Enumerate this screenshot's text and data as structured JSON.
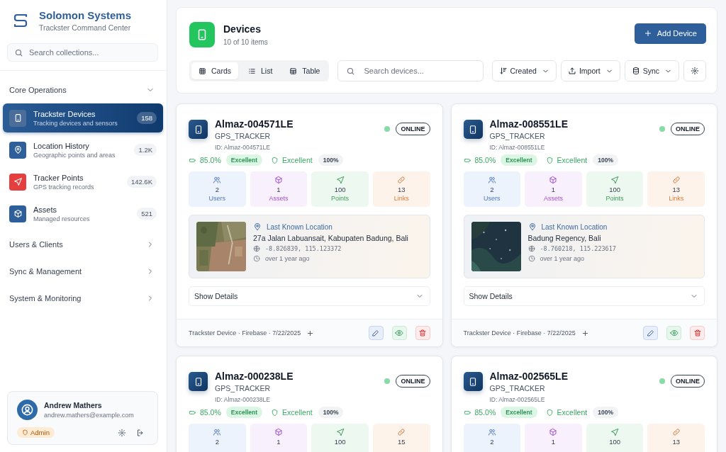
{
  "brand": {
    "title": "Solomon Systems",
    "subtitle": "Trackster Command Center"
  },
  "sidebar": {
    "search": {
      "placeholder": "Search collections..."
    },
    "sections": [
      {
        "label": "Core Operations",
        "expanded": true,
        "items": [
          {
            "title": "Trackster Devices",
            "subtitle": "Tracking devices and sensors",
            "count": "158",
            "selected": true,
            "kind": "device",
            "color": "#4a6d9a"
          },
          {
            "title": "Location History",
            "subtitle": "Geographic points and areas",
            "count": "1.2K",
            "selected": false,
            "kind": "pin",
            "color": "#2f5f9a"
          },
          {
            "title": "Tracker Points",
            "subtitle": "GPS tracking records",
            "count": "142.6K",
            "selected": false,
            "kind": "send",
            "color": "#e53e3e"
          },
          {
            "title": "Assets",
            "subtitle": "Managed resources",
            "count": "521",
            "selected": false,
            "kind": "box",
            "color": "#2f5f9a"
          }
        ]
      },
      {
        "label": "Users & Clients",
        "expanded": false
      },
      {
        "label": "Sync & Management",
        "expanded": false
      },
      {
        "label": "System & Monitoring",
        "expanded": false
      }
    ]
  },
  "user": {
    "name": "Andrew Mathers",
    "email": "andrew.mathers@example.com",
    "role": "Admin"
  },
  "header": {
    "title": "Devices",
    "subtitle": "10 of 10 items",
    "add_button": "Add Device"
  },
  "view_tabs": [
    {
      "label": "Cards",
      "kind": "grid",
      "selected": true
    },
    {
      "label": "List",
      "kind": "list",
      "selected": false
    },
    {
      "label": "Table",
      "kind": "table",
      "selected": false
    }
  ],
  "search": {
    "placeholder": "Search devices..."
  },
  "toolbar_buttons": [
    {
      "label": "Created",
      "kind": "sort"
    },
    {
      "label": "Import",
      "kind": "import"
    },
    {
      "label": "Sync",
      "kind": "sync"
    },
    {
      "kind": "settings"
    }
  ],
  "devices": [
    {
      "name": "Almaz-004571LE",
      "type": "GPS_TRACKER",
      "id": "ID: Almaz-004571LE",
      "online": true,
      "status": "ONLINE",
      "battery": "85.0%",
      "battery_badge": "Excellent",
      "signal": "Excellent",
      "signal_pct": "100%",
      "stats": [
        {
          "kind": "users",
          "value": "2",
          "label": "Users"
        },
        {
          "kind": "assets",
          "value": "1",
          "label": "Assets"
        },
        {
          "kind": "points",
          "value": "100",
          "label": "Points"
        },
        {
          "kind": "links",
          "value": "13",
          "label": "Links"
        }
      ],
      "location": {
        "title": "Last Known Location",
        "address": "27a Jalan Labuansait, Kabupaten Badung, Bali",
        "coords": "-8.826839, 115.123372",
        "time": "over 1 year ago"
      },
      "details": "Show Details",
      "footer": "Trackster Device · Firebase · 7/22/2025"
    },
    {
      "name": "Almaz-008551LE",
      "type": "GPS_TRACKER",
      "id": "ID: Almaz-008551LE",
      "online": true,
      "status": "ONLINE",
      "battery": "85.0%",
      "battery_badge": "Excellent",
      "signal": "Excellent",
      "signal_pct": "100%",
      "stats": [
        {
          "kind": "users",
          "value": "2",
          "label": "Users"
        },
        {
          "kind": "assets",
          "value": "1",
          "label": "Assets"
        },
        {
          "kind": "points",
          "value": "100",
          "label": "Points"
        },
        {
          "kind": "links",
          "value": "13",
          "label": "Links"
        }
      ],
      "location": {
        "title": "Last Known Location",
        "address": "Badung Regency, Bali",
        "coords": "-8.760218, 115.223617",
        "time": "over 1 year ago"
      },
      "details": "Show Details",
      "footer": "Trackster Device · Firebase · 7/22/2025"
    },
    {
      "name": "Almaz-000238LE",
      "type": "GPS_TRACKER",
      "id": "ID: Almaz-000238LE",
      "online": true,
      "status": "ONLINE",
      "battery": "85.0%",
      "battery_badge": "Excellent",
      "signal": "Excellent",
      "signal_pct": "100%",
      "stats": [
        {
          "kind": "users",
          "value": "2"
        },
        {
          "kind": "assets",
          "value": "1"
        },
        {
          "kind": "points",
          "value": "100"
        },
        {
          "kind": "links",
          "value": "15"
        }
      ]
    },
    {
      "name": "Almaz-002565LE",
      "type": "GPS_TRACKER",
      "id": "ID: Almaz-002565LE",
      "online": true,
      "status": "ONLINE",
      "battery": "85.0%",
      "battery_badge": "Excellent",
      "signal": "Excellent",
      "signal_pct": "100%",
      "stats": [
        {
          "kind": "users",
          "value": "2"
        },
        {
          "kind": "assets",
          "value": "1"
        },
        {
          "kind": "points",
          "value": "100"
        },
        {
          "kind": "links",
          "value": "13"
        }
      ]
    }
  ]
}
